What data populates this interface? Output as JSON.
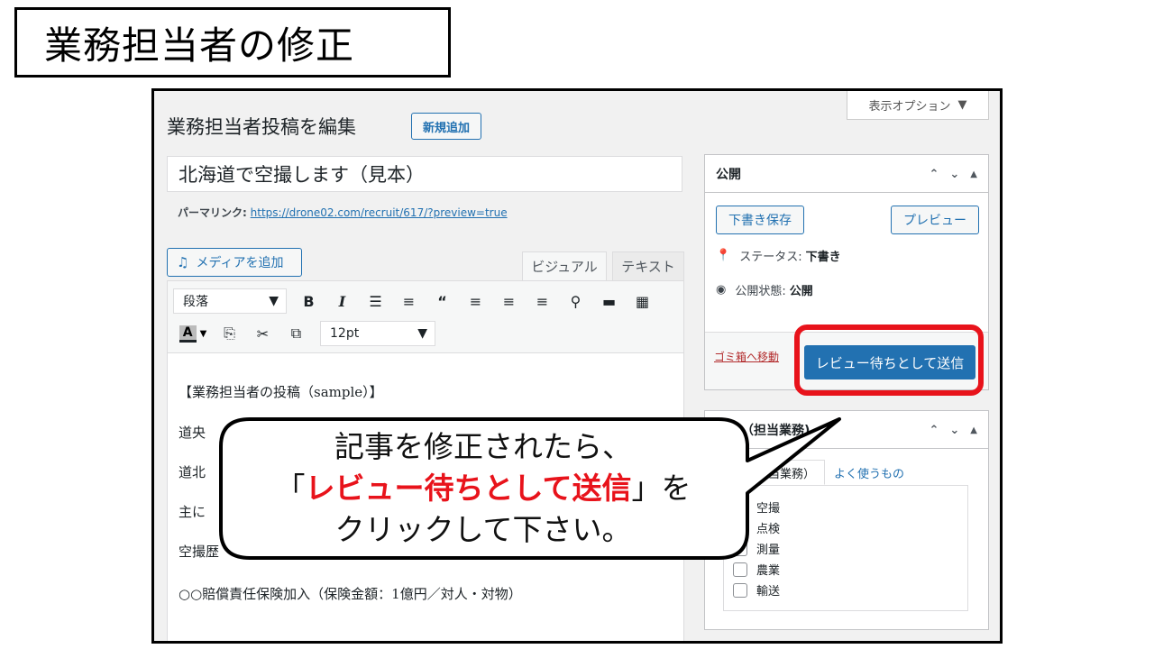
{
  "slide": {
    "title": "業務担当者の修正"
  },
  "screen_options": {
    "label": "表示オプション"
  },
  "header": {
    "page_title": "業務担当者投稿を編集",
    "add_new": "新規追加"
  },
  "post": {
    "title": "北海道で空撮します（見本）",
    "permalink_label": "パーマリンク:",
    "permalink_url": "https://drone02.com/recruit/617/?preview=true"
  },
  "editor": {
    "media_button": "メディアを追加",
    "tabs": [
      "ビジュアル",
      "テキスト"
    ],
    "format_select": "段落",
    "font_size": "12pt",
    "content": [
      "【業務担当者の投稿（sample）】",
      "道央",
      "道北",
      "主に",
      "空撮歴",
      "○○賠償責任保険加入（保険金額：1億円／対人・対物）"
    ]
  },
  "publish_box": {
    "title": "公開",
    "save_draft": "下書き保存",
    "preview": "プレビュー",
    "status_label": "ステータス:",
    "status_value": "下書き",
    "visibility_label": "公開状態:",
    "visibility_value": "公開",
    "trash": "ゴミ箱へ移動",
    "submit": "レビュー待ちとして送信"
  },
  "category_box": {
    "title": "ゴリ（担当業務)",
    "tab_all": "リ（担当業務）",
    "tab_popular": "よく使うもの",
    "items": [
      "空撮",
      "点検",
      "測量",
      "農業",
      "輸送"
    ]
  },
  "callout": {
    "line1": "記事を修正されたら、",
    "line2_open": "「",
    "line2_emph": "レビュー待ちとして送信",
    "line2_close": "」を",
    "line3": "クリックして下さい。"
  },
  "colors": {
    "accent_blue": "#2271b1",
    "highlight_red": "#e8131b",
    "trash_red": "#b32d2e"
  }
}
